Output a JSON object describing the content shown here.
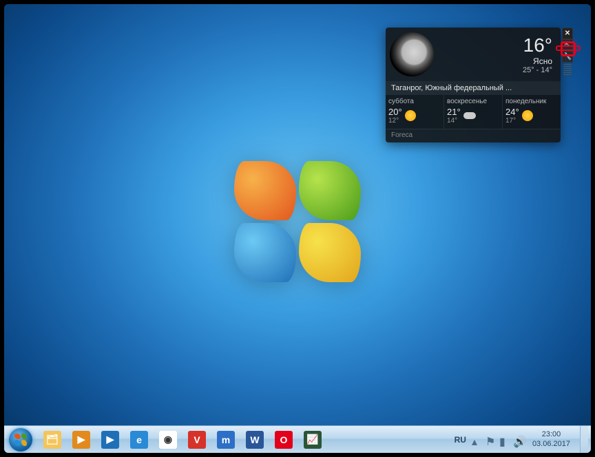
{
  "weather_gadget": {
    "temperature": "16°",
    "condition": "Ясно",
    "hi_lo": "25° - 14°",
    "location": "Таганрог, Южный федеральный ...",
    "brand": "Foreca",
    "forecast": [
      {
        "day": "суббота",
        "hi": "20°",
        "lo": "12°",
        "icon": "sun"
      },
      {
        "day": "воскресенье",
        "hi": "21°",
        "lo": "14°",
        "icon": "cloud"
      },
      {
        "day": "понедельник",
        "hi": "24°",
        "lo": "17°",
        "icon": "sun"
      }
    ],
    "controls": {
      "close": "✕",
      "size": "⇱",
      "options": "🔧"
    }
  },
  "taskbar": {
    "pinned": [
      {
        "name": "explorer",
        "color": "#f4c55a",
        "glyph": "🗂"
      },
      {
        "name": "wmplayer",
        "color": "#e28a1d",
        "glyph": "▶"
      },
      {
        "name": "mpc",
        "color": "#1f6fb7",
        "glyph": "▶"
      },
      {
        "name": "ie",
        "color": "#2a8ad6",
        "glyph": "e"
      },
      {
        "name": "chrome",
        "color": "#fff",
        "glyph": "◉"
      },
      {
        "name": "vivaldi",
        "color": "#d6322a",
        "glyph": "V"
      },
      {
        "name": "maxthon",
        "color": "#2d6fc6",
        "glyph": "m"
      },
      {
        "name": "word",
        "color": "#2a5699",
        "glyph": "W"
      },
      {
        "name": "opera",
        "color": "#e3001b",
        "glyph": "O"
      },
      {
        "name": "taskmgr",
        "color": "#2a5535",
        "glyph": "📈"
      }
    ]
  },
  "tray": {
    "language": "RU",
    "clock_time": "23:00",
    "clock_date": "03.06.2017"
  }
}
